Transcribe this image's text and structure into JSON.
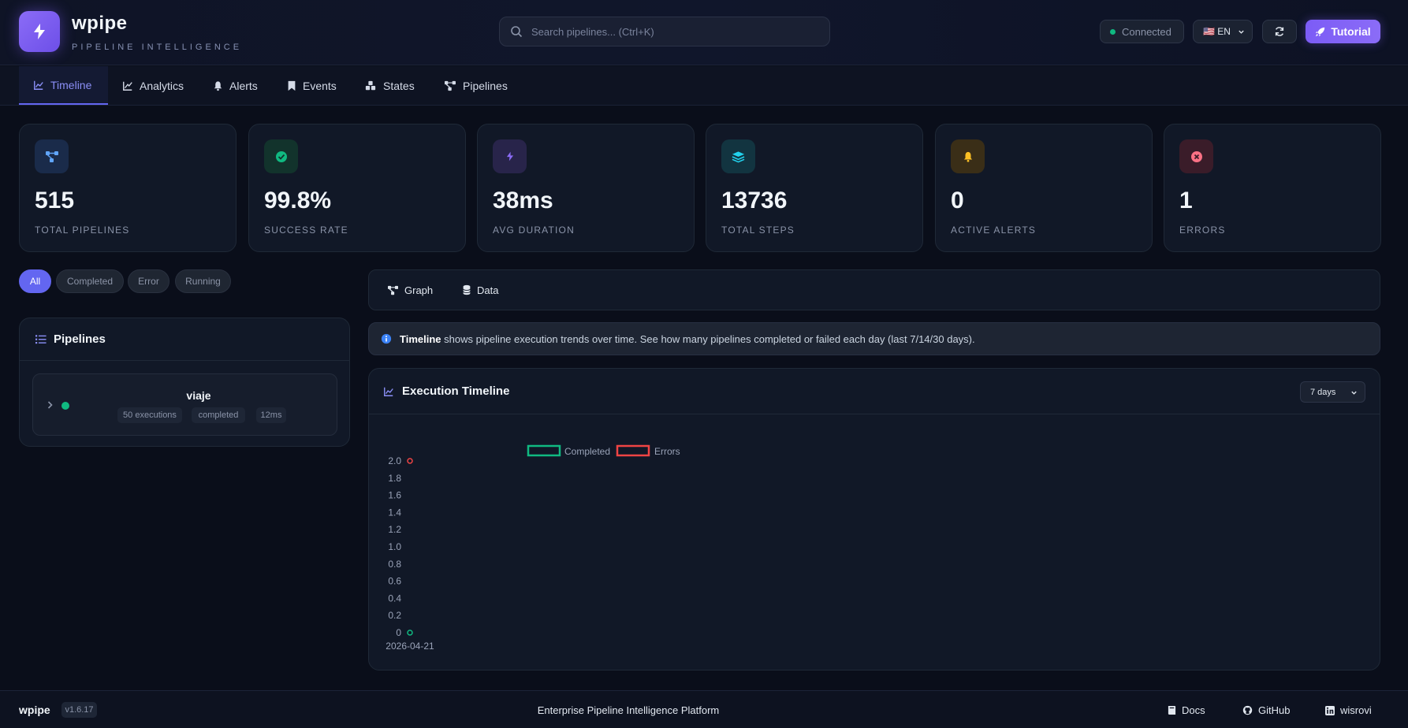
{
  "header": {
    "brand": "wpipe",
    "tagline": "PIPELINE INTELLIGENCE",
    "search_placeholder": "Search pipelines... (Ctrl+K)",
    "status": "Connected",
    "language": "🇺🇸 EN",
    "tutorial_label": "Tutorial"
  },
  "nav": {
    "tabs": [
      {
        "label": "Timeline",
        "icon": "line-chart-icon",
        "active": true
      },
      {
        "label": "Analytics",
        "icon": "trend-chart-icon"
      },
      {
        "label": "Alerts",
        "icon": "bell-icon"
      },
      {
        "label": "Events",
        "icon": "bookmark-icon"
      },
      {
        "label": "States",
        "icon": "cubes-icon"
      },
      {
        "label": "Pipelines",
        "icon": "pipeline-icon"
      }
    ]
  },
  "stats": [
    {
      "value": "515",
      "label": "TOTAL PIPELINES",
      "icon": "network-icon",
      "color": "#60a5fa",
      "bg": "#1a2b4a"
    },
    {
      "value": "99.8%",
      "label": "SUCCESS RATE",
      "icon": "check-circle-icon",
      "color": "#10b981",
      "bg": "#12332c"
    },
    {
      "value": "38ms",
      "label": "AVG DURATION",
      "icon": "bolt-icon",
      "color": "#8b6cf7",
      "bg": "#28244a"
    },
    {
      "value": "13736",
      "label": "TOTAL STEPS",
      "icon": "layers-icon",
      "color": "#22d3ee",
      "bg": "#123440"
    },
    {
      "value": "0",
      "label": "ACTIVE ALERTS",
      "icon": "bell-icon",
      "color": "#fbbf24",
      "bg": "#3a2e17"
    },
    {
      "value": "1",
      "label": "ERRORS",
      "icon": "x-circle-icon",
      "color": "#fb7185",
      "bg": "#3a1c29"
    }
  ],
  "filters": [
    "All",
    "Completed",
    "Error",
    "Running"
  ],
  "pipelines_panel": {
    "title": "Pipelines",
    "items": [
      {
        "name": "viaje",
        "executions": "50 executions",
        "status": "completed",
        "duration": "12ms"
      }
    ]
  },
  "view_toggle": {
    "graph": "Graph",
    "data": "Data"
  },
  "info": {
    "bold": "Timeline",
    "text": " shows pipeline execution trends over time. See how many pipelines completed or failed each day (last 7/14/30 days)."
  },
  "timeline": {
    "title": "Execution Timeline",
    "range": "7 days"
  },
  "chart_data": {
    "type": "line",
    "x": [
      "2026-04-21"
    ],
    "series": [
      {
        "name": "Completed",
        "values": [
          0
        ],
        "color": "#10b981"
      },
      {
        "name": "Errors",
        "values": [
          2
        ],
        "color": "#ef4444"
      }
    ],
    "yticks": [
      "0",
      "0.2",
      "0.4",
      "0.6",
      "0.8",
      "1.0",
      "1.2",
      "1.4",
      "1.6",
      "1.8",
      "2.0"
    ],
    "ylim": [
      0,
      2
    ],
    "legend": "top"
  },
  "footer": {
    "brand": "wpipe",
    "version": "v1.6.17",
    "tagline": "Enterprise Pipeline Intelligence Platform",
    "docs": "Docs",
    "github": "GitHub",
    "author": "wisrovi"
  }
}
